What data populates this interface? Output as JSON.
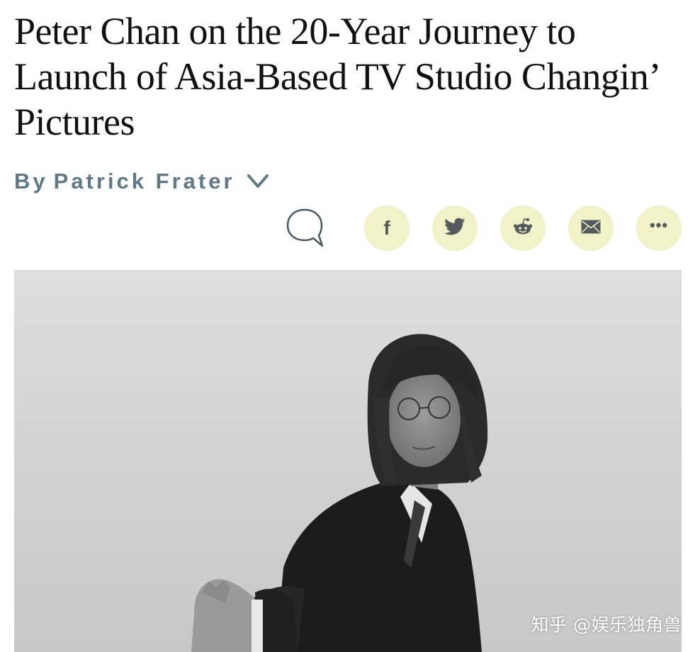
{
  "article": {
    "headline": "Peter Chan on the 20-Year Journey to Launch of Asia-Based TV Studio Changin’ Pictures",
    "byline": {
      "prefix": "By",
      "author": "Patrick Frater",
      "expand_icon": "chevron-down-icon"
    }
  },
  "actions": {
    "comment_icon": "comment-bubble-icon",
    "share": [
      {
        "id": "facebook",
        "icon": "facebook-icon",
        "glyph": "f"
      },
      {
        "id": "twitter",
        "icon": "twitter-icon"
      },
      {
        "id": "reddit",
        "icon": "reddit-icon"
      },
      {
        "id": "email",
        "icon": "email-icon"
      },
      {
        "id": "more",
        "icon": "more-icon",
        "glyph": "•••"
      }
    ],
    "share_bg_color": "#f1f2c8",
    "icon_color": "#555a5f"
  },
  "hero_image": {
    "style": "black-and-white portrait photo"
  },
  "watermark": {
    "text": "知乎 @娱乐独角兽"
  },
  "colors": {
    "byline": "#5f7a86",
    "headline": "#111111"
  }
}
